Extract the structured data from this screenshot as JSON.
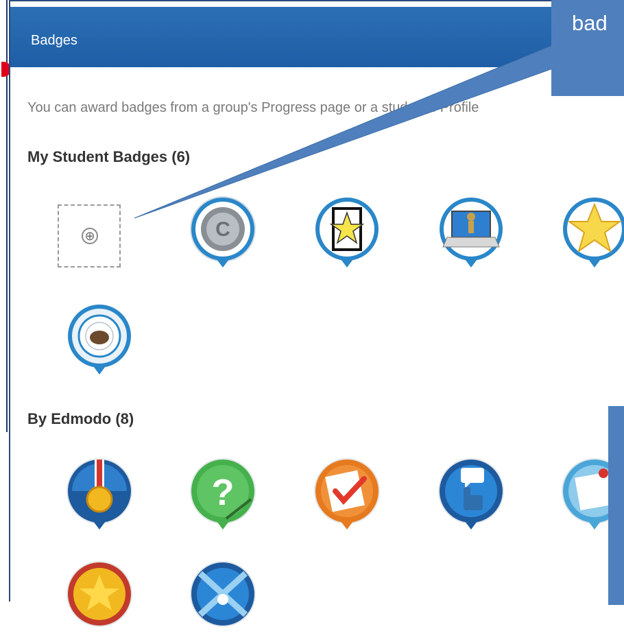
{
  "panel": {
    "title": "Badges",
    "intro": "You can award badges from a group's Progress page or a student's Profile"
  },
  "sections": {
    "my_student_badges": {
      "heading": "My Student Badges (6)",
      "add_icon": "⊕"
    },
    "by_edmodo": {
      "heading": "By Edmodo (8)"
    }
  },
  "callout": {
    "text": "bad"
  },
  "colors": {
    "header_blue": "#1d5ea6",
    "callout_blue": "#4f80bd",
    "badge_ring": "#2a87c9",
    "accent_red": "#e0001a"
  },
  "icons": {
    "student_badges": [
      "add-badge-icon",
      "copyright-icon",
      "star-frame-icon",
      "laptop-figure-icon",
      "star-icon",
      "montana-seal-icon"
    ],
    "edmodo_badges": [
      "medal-icon",
      "question-icon",
      "checklist-icon",
      "speech-hand-icon",
      "pin-note-icon",
      "gold-star-icon",
      "crossed-icon"
    ]
  }
}
